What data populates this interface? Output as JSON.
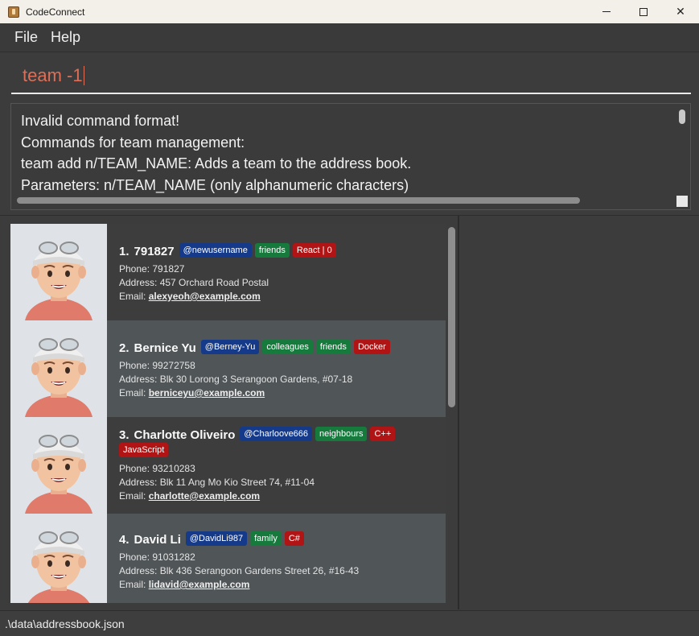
{
  "window": {
    "title": "CodeConnect",
    "minimize": "–",
    "maximize": "☐",
    "close": "✕"
  },
  "menu": {
    "file": "File",
    "help": "Help"
  },
  "command": {
    "value": "team -1"
  },
  "result": {
    "lines": [
      "Invalid command format!",
      "Commands for team management:",
      "team add n/TEAM_NAME: Adds a team to the address book.",
      "Parameters: n/TEAM_NAME (only alphanumeric characters)"
    ]
  },
  "contacts": [
    {
      "index": "1.",
      "name": "791827",
      "username": "@newusername",
      "groups": [
        "friends"
      ],
      "tech": [
        "React | 0"
      ],
      "phone": "Phone: 791827",
      "address": "Address: 457 Orchard Road Postal",
      "email_label": "Email:",
      "email": "alexyeoh@example.com"
    },
    {
      "index": "2.",
      "name": "Bernice Yu",
      "username": "@Berney-Yu",
      "groups": [
        "colleagues",
        "friends"
      ],
      "tech": [
        "Docker"
      ],
      "phone": "Phone: 99272758",
      "address": "Address: Blk 30 Lorong 3 Serangoon Gardens, #07-18",
      "email_label": "Email:",
      "email": "berniceyu@example.com"
    },
    {
      "index": "3.",
      "name": "Charlotte Oliveiro",
      "username": "@Charloove666",
      "groups": [
        "neighbours"
      ],
      "tech": [
        "C++",
        "JavaScript"
      ],
      "phone": "Phone: 93210283",
      "address": "Address: Blk 11 Ang Mo Kio Street 74, #11-04",
      "email_label": "Email:",
      "email": "charlotte@example.com"
    },
    {
      "index": "4.",
      "name": "David Li",
      "username": "@DavidLi987",
      "groups": [
        "family"
      ],
      "tech": [
        "C#"
      ],
      "phone": "Phone: 91031282",
      "address": "Address: Blk 436 Serangoon Gardens Street 26, #16-43",
      "email_label": "Email:",
      "email": "lidavid@example.com"
    }
  ],
  "status": {
    "path": ".\\data\\addressbook.json"
  },
  "colors": {
    "command": "#dd6f58",
    "user_tag": "#153a8a",
    "group_tag": "#167a3d",
    "tech_tag": "#b11414"
  },
  "icons": {
    "app": "app-icon",
    "avatar": "avatar-icon"
  }
}
